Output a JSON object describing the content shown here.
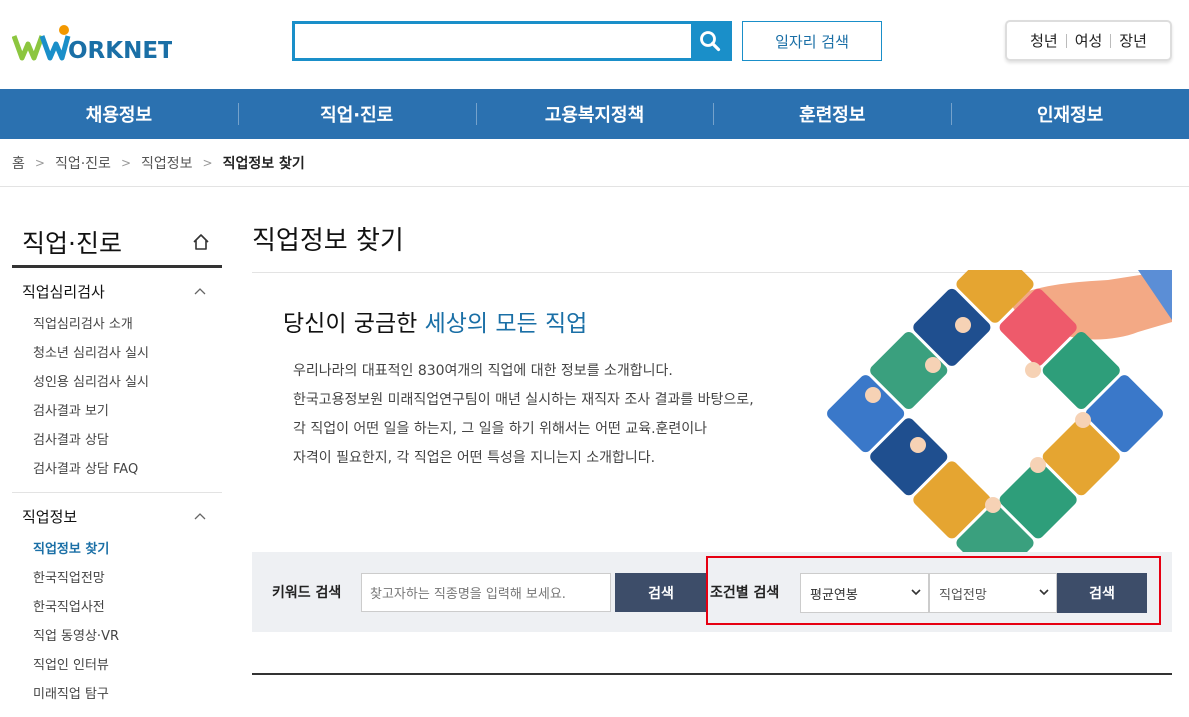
{
  "header": {
    "logo_text": "WORKNET",
    "search_placeholder": "",
    "job_search_label": "일자리 검색",
    "quick_links": [
      "청년",
      "여성",
      "장년"
    ]
  },
  "gnb": [
    "채용정보",
    "직업·진로",
    "고용복지정책",
    "훈련정보",
    "인재정보"
  ],
  "breadcrumb": [
    "홈",
    "직업·진로",
    "직업정보",
    "직업정보 찾기"
  ],
  "lnb": {
    "title": "직업·진로",
    "groups": [
      {
        "title": "직업심리검사",
        "items": [
          "직업심리검사 소개",
          "청소년 심리검사 실시",
          "성인용 심리검사 실시",
          "검사결과 보기",
          "검사결과 상담",
          "검사결과 상담 FAQ"
        ]
      },
      {
        "title": "직업정보",
        "items": [
          "직업정보 찾기",
          "한국직업전망",
          "한국직업사전",
          "직업 동영상·VR",
          "직업인 인터뷰",
          "미래직업 탐구"
        ]
      }
    ]
  },
  "content": {
    "page_title": "직업정보 찾기",
    "intro_heading_prefix": "당신이 궁금한 ",
    "intro_heading_highlight": "세상의 모든 직업",
    "intro_lines": [
      "우리나라의 대표적인 830여개의 직업에 대한 정보를 소개합니다.",
      "한국고용정보원 미래직업연구팀이 매년 실시하는 재직자 조사 결과를 바탕으로,",
      "각 직업이 어떤 일을 하는지, 그 일을 하기 위해서는 어떤 교육.훈련이나",
      "자격이 필요한지, 각 직업은 어떤 특성을 지니는지 소개합니다."
    ]
  },
  "search": {
    "keyword_label": "키워드 검색",
    "keyword_placeholder": "찾고자하는 직종명을 입력해 보세요.",
    "keyword_button": "검색",
    "condition_label": "조건별 검색",
    "select1_value": "평균연봉",
    "select2_value": "직업전망",
    "condition_button": "검색"
  },
  "colors": {
    "primary_blue": "#2b71b0",
    "accent_blue": "#1a8fc9",
    "button_navy": "#3d4d69",
    "highlight_red": "#e60012"
  }
}
